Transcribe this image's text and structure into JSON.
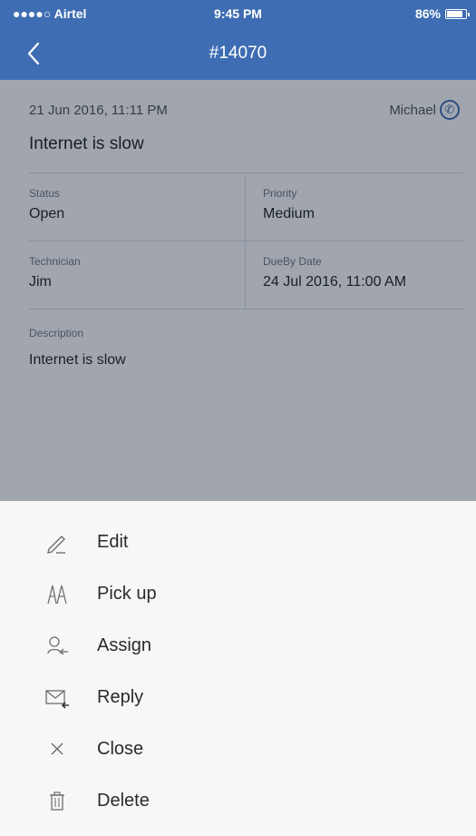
{
  "status_bar": {
    "carrier": "●●●●○ Airtel",
    "time": "9:45 PM",
    "battery": "86%",
    "battery_level": 0.86
  },
  "nav": {
    "back_icon": "chevron-left-icon",
    "title": "#14070"
  },
  "ticket": {
    "date": "21 Jun 2016, 11:11 PM",
    "requester": "Michael",
    "subject": "Internet is slow",
    "fields": [
      {
        "label": "Status",
        "value": "Open"
      },
      {
        "label": "Priority",
        "value": "Medium"
      },
      {
        "label": "Technician",
        "value": "Jim"
      },
      {
        "label": "DueBy Date",
        "value": "24 Jul 2016, 11:00 AM"
      }
    ],
    "description_label": "Description",
    "description": "Internet is slow"
  },
  "actions": [
    {
      "label": "Edit",
      "icon": "pencil-icon"
    },
    {
      "label": "Pick up",
      "icon": "pick-up-icon"
    },
    {
      "label": "Assign",
      "icon": "assign-icon"
    },
    {
      "label": "Reply",
      "icon": "reply-icon"
    },
    {
      "label": "Close",
      "icon": "close-icon"
    },
    {
      "label": "Delete",
      "icon": "trash-icon"
    }
  ],
  "colors": {
    "brand": "#3f6db3",
    "sheet": "#f7f7f8"
  }
}
